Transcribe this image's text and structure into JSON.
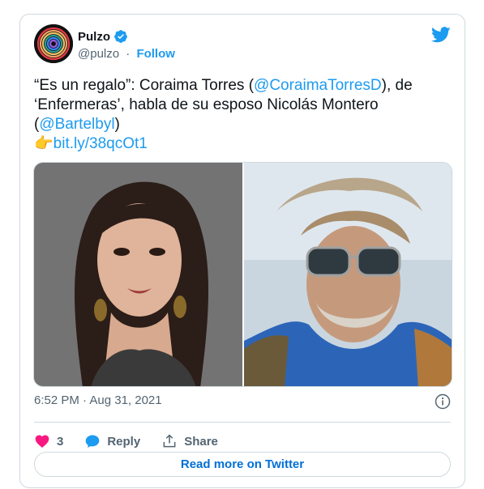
{
  "author": {
    "name": "Pulzo",
    "handle": "@pulzo",
    "separator": "·",
    "follow_label": "Follow"
  },
  "tweet": {
    "line1_pre": "“Es un regalo”: Coraima Torres (",
    "mention1": "@CoraimaTorresD",
    "line1_post": "), de",
    "line2": "‘Enfermeras’, habla de su esposo Nicolás Montero",
    "line3_pre": "(",
    "mention2": "@Bartelbyl",
    "line3_post": ")",
    "link_emoji": "👉",
    "link": "bit.ly/38qcOt1"
  },
  "timestamp": "6:52 PM · Aug 31, 2021",
  "actions": {
    "like_count": "3",
    "reply_label": "Reply",
    "share_label": "Share"
  },
  "read_more_label": "Read more on Twitter",
  "colors": {
    "accent": "#1d9bf0",
    "heart": "#f91880",
    "text": "#0f1419",
    "muted": "#536471"
  }
}
